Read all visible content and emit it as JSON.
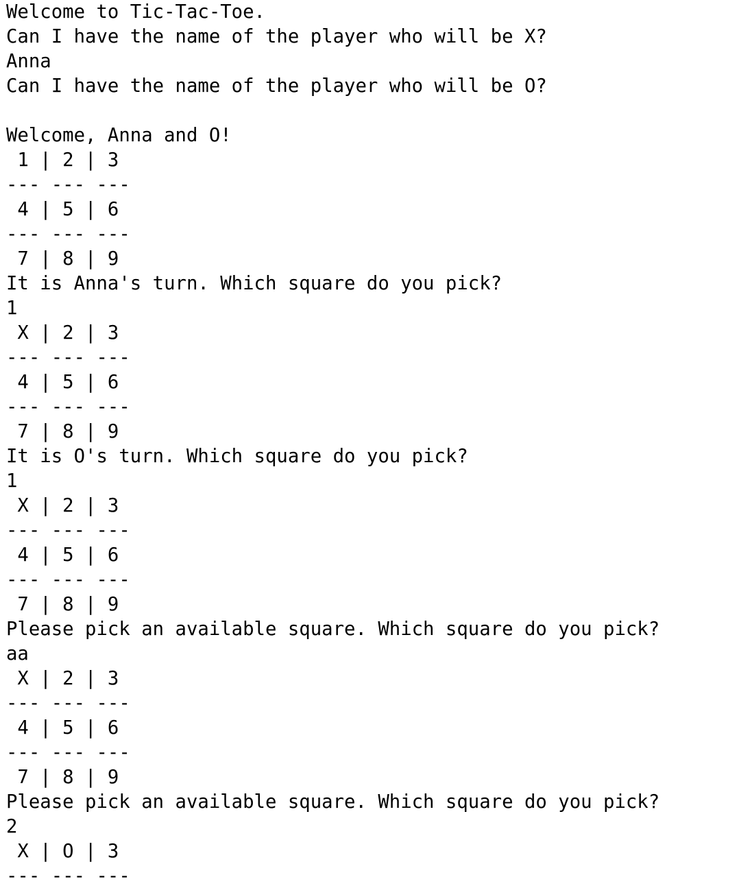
{
  "terminal": {
    "lines": [
      "Welcome to Tic-Tac-Toe.",
      "Can I have the name of the player who will be X?",
      "Anna",
      "Can I have the name of the player who will be O?",
      "",
      "Welcome, Anna and O!",
      " 1 | 2 | 3",
      "--- --- ---",
      " 4 | 5 | 6",
      "--- --- ---",
      " 7 | 8 | 9",
      "It is Anna's turn. Which square do you pick?",
      "1",
      " X | 2 | 3",
      "--- --- ---",
      " 4 | 5 | 6",
      "--- --- ---",
      " 7 | 8 | 9",
      "It is O's turn. Which square do you pick?",
      "1",
      " X | 2 | 3",
      "--- --- ---",
      " 4 | 5 | 6",
      "--- --- ---",
      " 7 | 8 | 9",
      "Please pick an available square. Which square do you pick?",
      "aa",
      " X | 2 | 3",
      "--- --- ---",
      " 4 | 5 | 6",
      "--- --- ---",
      " 7 | 8 | 9",
      "Please pick an available square. Which square do you pick?",
      "2",
      " X | O | 3",
      "--- --- ---"
    ]
  }
}
